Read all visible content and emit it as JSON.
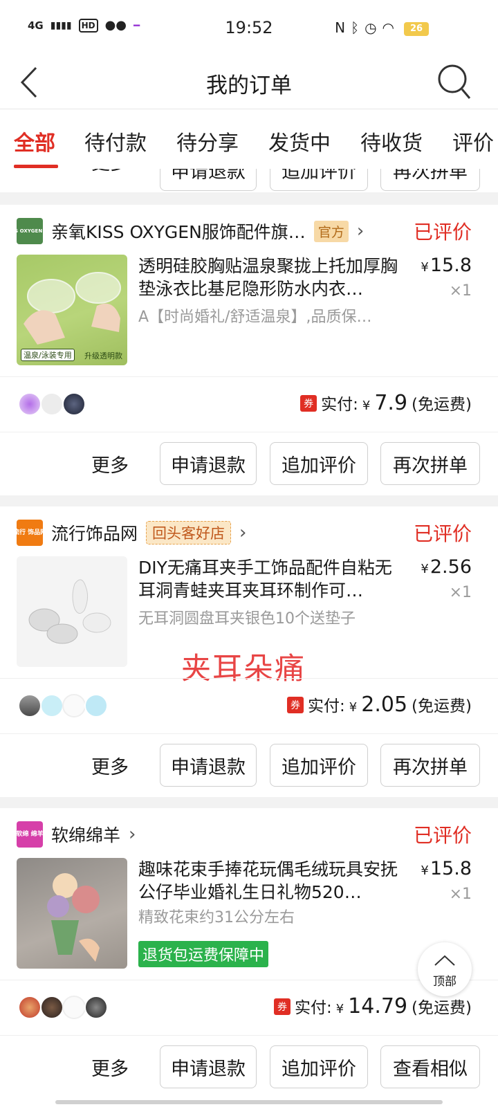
{
  "status_bar": {
    "network": "4G",
    "hd": "HD",
    "time": "19:52",
    "battery": "26"
  },
  "nav": {
    "title": "我的订单"
  },
  "tabs": [
    "全部",
    "待付款",
    "待分享",
    "发货中",
    "待收货",
    "评价"
  ],
  "buttons": {
    "more": "更多",
    "refund": "申请退款",
    "add_review": "追加评价",
    "reorder": "再次拼单",
    "similar": "查看相似"
  },
  "orders": [
    {
      "shop_name": "亲氧KISS OXYGEN服饰配件旗…",
      "shop_logo_text": "KISS OXYGEN 亲氧",
      "badge": "官方",
      "status": "已评价",
      "image_caption_left": "温泉/泳装专用",
      "image_caption_right": "升级透明款",
      "title": "透明硅胶胸贴温泉聚拢上托加厚胸垫泳衣比基尼隐形防水内衣…",
      "spec": "A【时尚婚礼/舒适温泉】,品质保…",
      "price": "15.8",
      "qty": "×1",
      "pay_label": "实付:",
      "pay_amount": "7.9",
      "shipping": "(免运费)",
      "coupon": "券"
    },
    {
      "shop_name": "流行饰品网",
      "shop_logo_text": "流行 饰品网",
      "badge": "回头客好店",
      "status": "已评价",
      "title": "DIY无痛耳夹手工饰品配件自粘无耳洞青蛙夹耳夹耳环制作可…",
      "spec": "无耳洞圆盘耳夹银色10个送垫子",
      "overlay": "夹耳朵痛",
      "price": "2.56",
      "qty": "×1",
      "pay_label": "实付:",
      "pay_amount": "2.05",
      "shipping": "(免运费)",
      "coupon": "券"
    },
    {
      "shop_name": "软绵绵羊",
      "shop_logo_text": "软绵 绵羊",
      "status": "已评价",
      "title": "趣味花束手捧花玩偶毛绒玩具安抚公仔毕业婚礼生日礼物520…",
      "spec": "精致花束约31公分左右",
      "tag": "退货包运费保障中",
      "price": "15.8",
      "qty": "×1",
      "pay_label": "实付:",
      "pay_amount": "14.79",
      "shipping": "(免运费)",
      "coupon": "券"
    }
  ],
  "currency": "¥",
  "back_to_top": "顶部",
  "colors": {
    "accent": "#e02e24",
    "green_tag": "#2bb24c"
  }
}
